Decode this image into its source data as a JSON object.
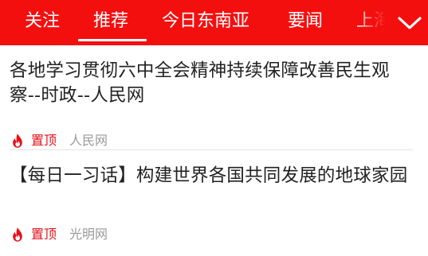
{
  "tabs": [
    {
      "label": "关注",
      "selected": false
    },
    {
      "label": "推荐",
      "selected": true
    },
    {
      "label": "今日东南亚",
      "selected": false
    },
    {
      "label": "要闻",
      "selected": false
    },
    {
      "label": "上海",
      "selected": false
    }
  ],
  "colors": {
    "topbar": "#f40f0f",
    "badge": "#e6101a",
    "source": "#9a9a9a",
    "title": "#222222"
  },
  "icons": {
    "expand": "chevron-down-icon",
    "pinned": "fire-icon"
  },
  "news": [
    {
      "title": "各地学习贯彻六中全会精神持续保障改善民生观察--时政--人民网",
      "badge": "置顶",
      "source": "人民网"
    },
    {
      "title": "【每日一习话】构建世界各国共同发展的地球家园",
      "badge": "置顶",
      "source": "光明网"
    }
  ]
}
